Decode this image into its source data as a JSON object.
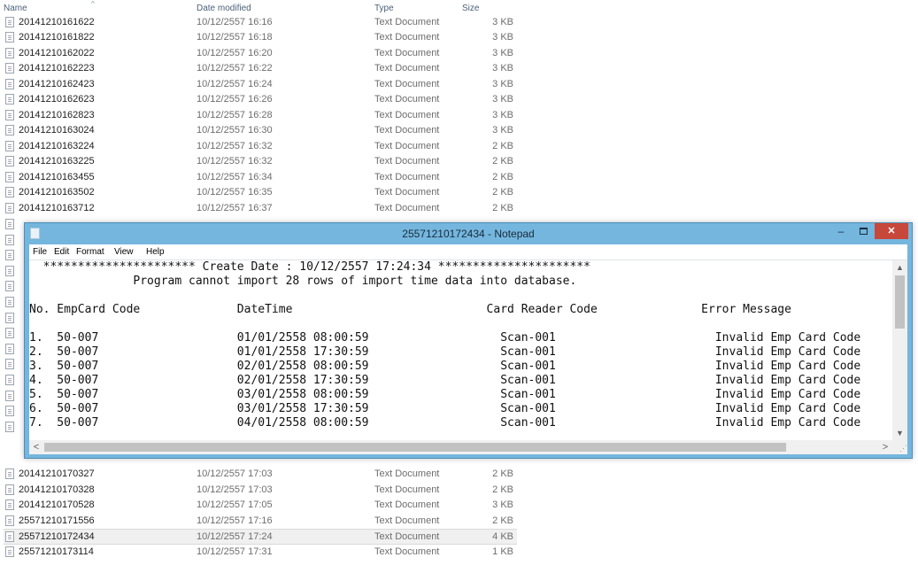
{
  "explorer": {
    "columns": {
      "name": "Name",
      "date": "Date modified",
      "type": "Type",
      "size": "Size"
    },
    "sort_icon": "sort-up-caret",
    "files": [
      {
        "name": "20141210161622",
        "date": "10/12/2557 16:16",
        "type": "Text Document",
        "size": "3 KB"
      },
      {
        "name": "20141210161822",
        "date": "10/12/2557 16:18",
        "type": "Text Document",
        "size": "3 KB"
      },
      {
        "name": "20141210162022",
        "date": "10/12/2557 16:20",
        "type": "Text Document",
        "size": "3 KB"
      },
      {
        "name": "20141210162223",
        "date": "10/12/2557 16:22",
        "type": "Text Document",
        "size": "3 KB"
      },
      {
        "name": "20141210162423",
        "date": "10/12/2557 16:24",
        "type": "Text Document",
        "size": "3 KB"
      },
      {
        "name": "20141210162623",
        "date": "10/12/2557 16:26",
        "type": "Text Document",
        "size": "3 KB"
      },
      {
        "name": "20141210162823",
        "date": "10/12/2557 16:28",
        "type": "Text Document",
        "size": "3 KB"
      },
      {
        "name": "20141210163024",
        "date": "10/12/2557 16:30",
        "type": "Text Document",
        "size": "3 KB"
      },
      {
        "name": "20141210163224",
        "date": "10/12/2557 16:32",
        "type": "Text Document",
        "size": "2 KB"
      },
      {
        "name": "20141210163225",
        "date": "10/12/2557 16:32",
        "type": "Text Document",
        "size": "2 KB"
      },
      {
        "name": "20141210163455",
        "date": "10/12/2557 16:34",
        "type": "Text Document",
        "size": "2 KB"
      },
      {
        "name": "20141210163502",
        "date": "10/12/2557 16:35",
        "type": "Text Document",
        "size": "2 KB"
      },
      {
        "name": "20141210163712",
        "date": "10/12/2557 16:37",
        "type": "Text Document",
        "size": "2 KB"
      },
      {
        "name": "20141210170327",
        "date": "10/12/2557 17:03",
        "type": "Text Document",
        "size": "2 KB"
      },
      {
        "name": "20141210170328",
        "date": "10/12/2557 17:03",
        "type": "Text Document",
        "size": "2 KB"
      },
      {
        "name": "20141210170528",
        "date": "10/12/2557 17:05",
        "type": "Text Document",
        "size": "3 KB"
      },
      {
        "name": "25571210171556",
        "date": "10/12/2557 17:16",
        "type": "Text Document",
        "size": "2 KB"
      },
      {
        "name": "25571210172434",
        "date": "10/12/2557 17:24",
        "type": "Text Document",
        "size": "4 KB",
        "selected": true
      },
      {
        "name": "25571210173114",
        "date": "10/12/2557 17:31",
        "type": "Text Document",
        "size": "1 KB"
      }
    ]
  },
  "notepad": {
    "title": "25571210172434 - Notepad",
    "menu": [
      "File",
      "Edit",
      "Format",
      "View",
      "Help"
    ],
    "controls": {
      "minimize": "–",
      "close": "✕"
    },
    "lines": [
      "  ********************** Create Date : 10/12/2557 17:24:34 **********************",
      "               Program cannot import 28 rows of import time data into database.",
      "",
      "No. EmpCard Code              DateTime                            Card Reader Code               Error Message",
      "",
      "1.  50-007                    01/01/2558 08:00:59                   Scan-001                       Invalid Emp Card Code",
      "2.  50-007                    01/01/2558 17:30:59                   Scan-001                       Invalid Emp Card Code",
      "3.  50-007                    02/01/2558 08:00:59                   Scan-001                       Invalid Emp Card Code",
      "4.  50-007                    02/01/2558 17:30:59                   Scan-001                       Invalid Emp Card Code",
      "5.  50-007                    03/01/2558 08:00:59                   Scan-001                       Invalid Emp Card Code",
      "6.  50-007                    03/01/2558 17:30:59                   Scan-001                       Invalid Emp Card Code",
      "7.  50-007                    04/01/2558 08:00:59                   Scan-001                       Invalid Emp Card Code"
    ],
    "scrollbar": {
      "up": "▲",
      "down": "▼",
      "left": "<",
      "right": ">"
    }
  },
  "colors": {
    "titlebar": "#74b6de",
    "close": "#c7473b",
    "selected_row": "#f0f0f0"
  }
}
